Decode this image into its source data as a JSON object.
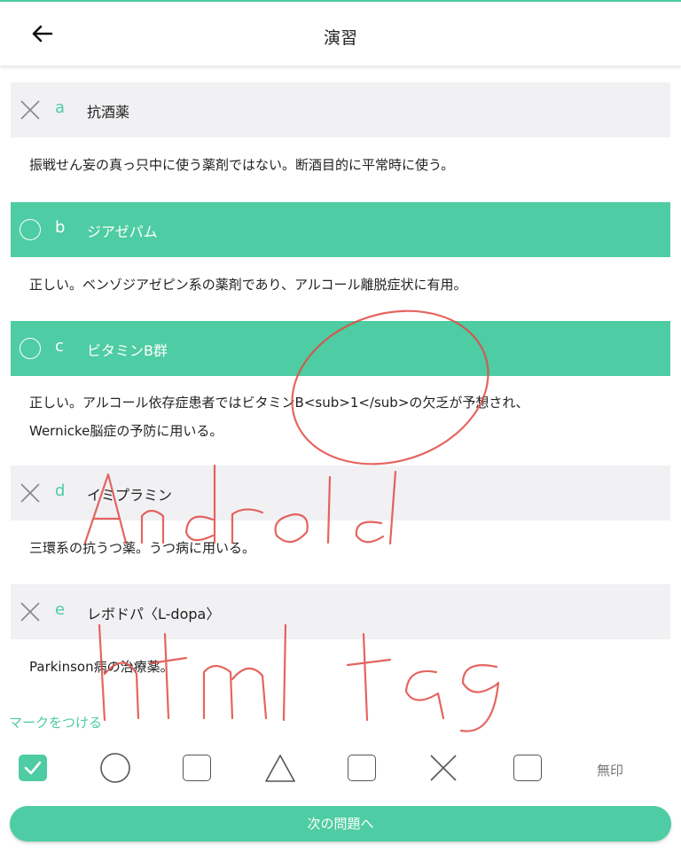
{
  "header": {
    "title": "演習",
    "back_icon": "arrow-left-icon"
  },
  "choices": [
    {
      "letter": "a",
      "text": "抗酒薬",
      "state": "wrong",
      "explanation": "振戦せん妄の真っ只中に使う薬剤ではない。断酒目的に平常時に使う。"
    },
    {
      "letter": "b",
      "text": "ジアゼパム",
      "state": "selected",
      "explanation": "正しい。ベンゾジアゼピン系の薬剤であり、アルコール離脱症状に有用。"
    },
    {
      "letter": "c",
      "text": "ビタミンB群",
      "state": "selected",
      "explanation_line1": "正しい。アルコール依存症患者ではビタミンB<sub>1</sub>の欠乏が予想され、",
      "explanation_line2": "Wernicke脳症の予防に用いる。"
    },
    {
      "letter": "d",
      "text": "イミプラミン",
      "state": "wrong",
      "explanation": "三環系の抗うつ薬。うつ病に用いる。"
    },
    {
      "letter": "e",
      "text": "レボドパ〈L-dopa〉",
      "state": "wrong",
      "explanation": "Parkinson病の治療薬。"
    }
  ],
  "marks": {
    "title": "マークをつける",
    "icons": [
      "checkbox-checked-icon",
      "circle-icon",
      "checkbox-icon",
      "triangle-icon",
      "checkbox-icon",
      "cross-icon",
      "checkbox-icon"
    ],
    "none_label": "無印"
  },
  "next_button": "次の問題へ",
  "annotations": {
    "word1": "Android",
    "word2": "html tag"
  },
  "colors": {
    "accent": "#4ecca3",
    "row_bg": "#f1f1f4",
    "annotation": "#e04b45"
  }
}
